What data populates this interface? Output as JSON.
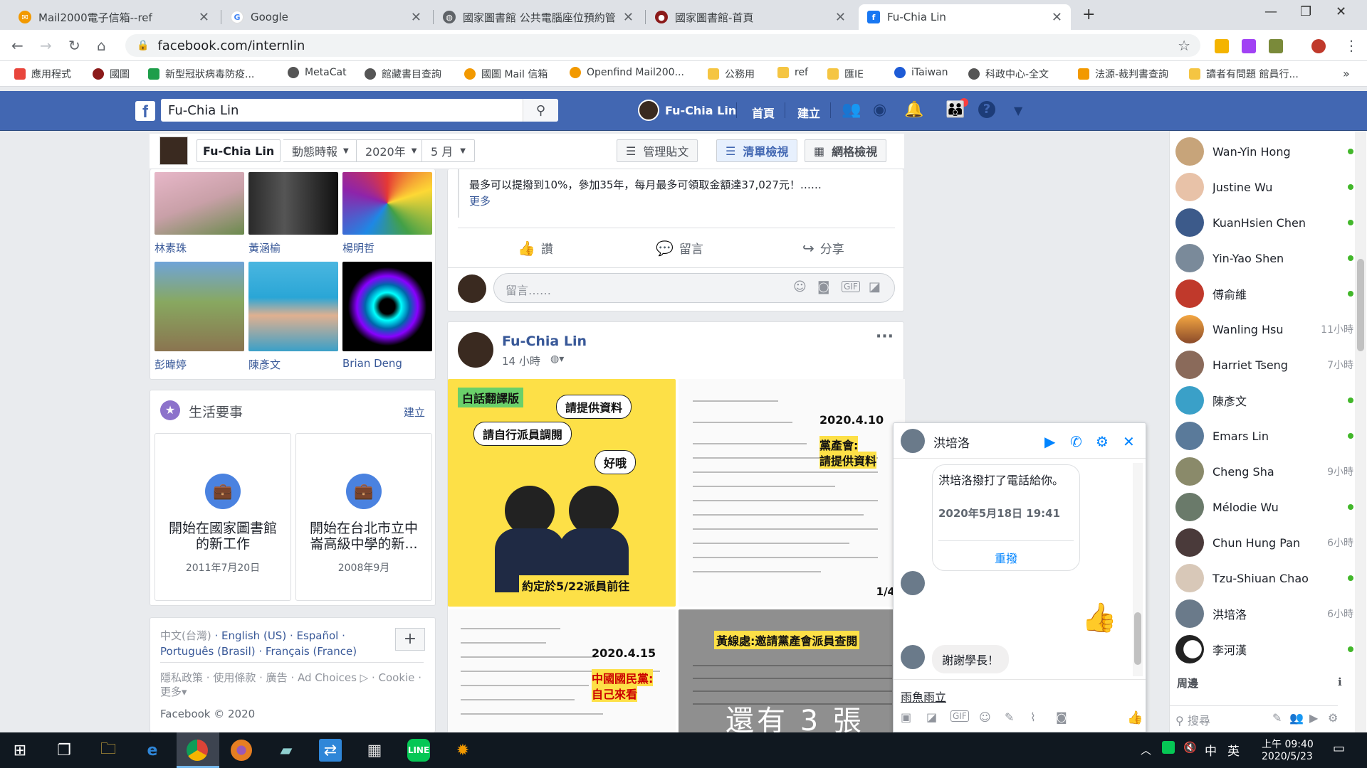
{
  "browser": {
    "tabs": [
      {
        "title": "Mail2000電子信箱--ref",
        "favicon": "mail-icon",
        "color": "#f29900"
      },
      {
        "title": "Google",
        "favicon": "google-icon",
        "color": "#4285f4"
      },
      {
        "title": "國家圖書館 公共電腦座位預約管",
        "favicon": "globe-icon",
        "color": "#5f6368"
      },
      {
        "title": "國家圖書館-首頁",
        "favicon": "ncl-icon",
        "color": "#8b1a1a"
      },
      {
        "title": "Fu-Chia Lin",
        "favicon": "facebook-icon",
        "color": "#1877f2"
      }
    ],
    "url": "facebook.com/internlin",
    "bookmarks": [
      {
        "label": "應用程式",
        "color": "#e8453c"
      },
      {
        "label": "國圖",
        "color": "#8b1a1a"
      },
      {
        "label": "新型冠狀病毒防疫...",
        "color": "#1e9e4a"
      },
      {
        "label": "MetaCat",
        "color": "#555555"
      },
      {
        "label": "館藏書目查詢",
        "color": "#555555"
      },
      {
        "label": "國圖 Mail 信箱",
        "color": "#f29900"
      },
      {
        "label": "Openfind Mail200...",
        "color": "#f29900"
      },
      {
        "label": "公務用",
        "color": "#f5c542"
      },
      {
        "label": "ref",
        "color": "#f5c542"
      },
      {
        "label": "匯IE",
        "color": "#f5c542"
      },
      {
        "label": "iTaiwan",
        "color": "#1d5bd6"
      },
      {
        "label": "科政中心-全文",
        "color": "#555555"
      },
      {
        "label": "法源-裁判書查詢",
        "color": "#f29900"
      },
      {
        "label": "讀者有問題 館員行...",
        "color": "#f5c542"
      }
    ],
    "more": "»"
  },
  "fb": {
    "search_value": "Fu-Chia Lin",
    "profile_name": "Fu-Chia Lin",
    "nav_home": "首頁",
    "nav_create": "建立",
    "brand_color": "#4267b2"
  },
  "subheader": {
    "name": "Fu-Chia Lin",
    "timeline": "動態時報",
    "year": "2020年",
    "month": "5 月",
    "manage": "管理貼文",
    "list_view": "清單檢視",
    "grid_view": "網格檢視"
  },
  "friends": [
    {
      "name": "林素珠"
    },
    {
      "name": "黃涵榆"
    },
    {
      "name": "楊明哲"
    },
    {
      "name": "彭暐婷"
    },
    {
      "name": "陳彥文"
    },
    {
      "name": "Brian Deng"
    }
  ],
  "life_events": {
    "title": "生活要事",
    "create": "建立",
    "items": [
      {
        "title": "開始在國家圖書館的新工作",
        "date": "2011年7月20日"
      },
      {
        "title": "開始在台北市立中崙高級中學的新...",
        "date": "2008年9月"
      }
    ]
  },
  "footer": {
    "languages": [
      "中文(台灣)",
      "English (US)",
      "Español",
      "Português (Brasil)",
      "Français (France)"
    ],
    "links": [
      "隱私政策",
      "使用條款",
      "廣告",
      "Ad Choices",
      "Cookie",
      "更多"
    ],
    "copyright": "Facebook © 2020"
  },
  "post1": {
    "text": "最多可以提撥到10%，參加35年，每月最多可領取金額達37,027元！……",
    "more": "更多",
    "like": "讚",
    "comment": "留言",
    "share": "分享",
    "comment_placeholder": "留言……"
  },
  "post2": {
    "author": "Fu-Chia Lin",
    "time": "14 小時",
    "img1": {
      "tag": "白話翻譯版",
      "b1": "請提供資料",
      "b2": "請自行派員調閱",
      "b3": "好哦",
      "caption": "約定於5/22派員前往"
    },
    "img2": {
      "date": "2020.4.10",
      "hl1": "黨產會:",
      "hl2": "請提供資料",
      "counter": "1/4"
    },
    "img3": {
      "date": "2020.4.15",
      "hl1": "中國國民黨:",
      "hl2": "自己來看"
    },
    "img4": {
      "title": "黃線處:邀請黨產會派員查閱",
      "overlay": "還有 3 張"
    }
  },
  "chat": {
    "name": "洪培洛",
    "call_msg": "洪培洛撥打了電話給你。",
    "call_time": "2020年5月18日 19:41",
    "redial": "重撥",
    "reply": "謝謝學長！",
    "input_value": "雨魚雨立"
  },
  "contacts": [
    {
      "name": "Wan-Yin Hong",
      "status": ""
    },
    {
      "name": "Justine Wu",
      "status": ""
    },
    {
      "name": "KuanHsien Chen",
      "status": ""
    },
    {
      "name": "Yin-Yao Shen",
      "status": ""
    },
    {
      "name": "傅俞維",
      "status": ""
    },
    {
      "name": "Wanling Hsu",
      "status": "11小時"
    },
    {
      "name": "Harriet Tseng",
      "status": "7小時"
    },
    {
      "name": "陳彥文",
      "status": ""
    },
    {
      "name": "Emars Lin",
      "status": ""
    },
    {
      "name": "Cheng Sha",
      "status": "9小時"
    },
    {
      "name": "Mélodie Wu",
      "status": ""
    },
    {
      "name": "Chun Hung Pan",
      "status": "6小時"
    },
    {
      "name": "Tzu-Shiuan Chao",
      "status": ""
    },
    {
      "name": "洪培洛",
      "status": "6小時"
    },
    {
      "name": "李河漢",
      "status": ""
    }
  ],
  "sidebar": {
    "group": "周邊",
    "search_placeholder": "搜尋"
  },
  "taskbar": {
    "time": "上午 09:40",
    "date": "2020/5/23",
    "ime": "中",
    "ime2": "英"
  }
}
